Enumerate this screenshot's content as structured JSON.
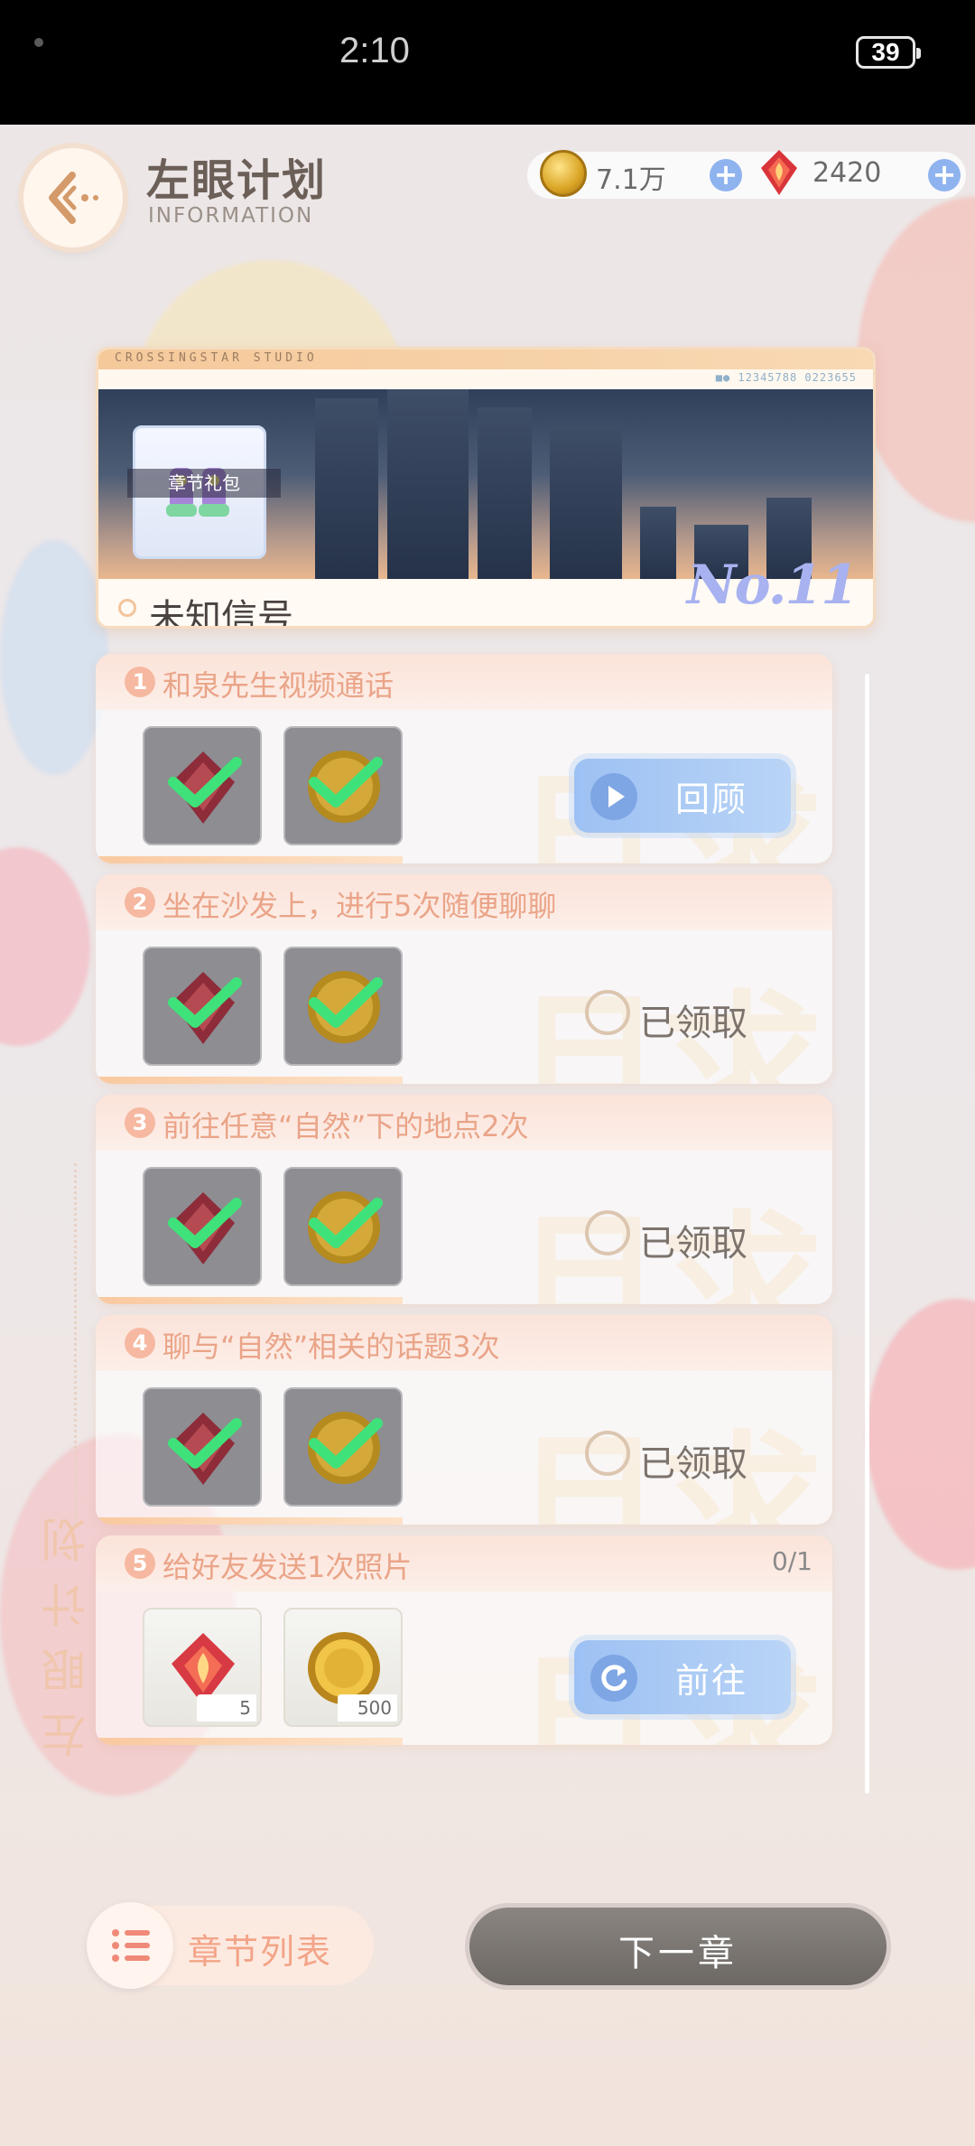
{
  "status_bar": {
    "time": "2:10",
    "battery": "39"
  },
  "header": {
    "title": "左眼计划",
    "subtitle": "INFORMATION",
    "coins": "7.1万",
    "gems": "2420"
  },
  "banner": {
    "studio": "CROSSINGSTAR STUDIO",
    "code": "■● 12345788 0223655",
    "gift_label": "章节礼包",
    "chapter_name": "未知信号",
    "chapter_no": "No.11"
  },
  "tasks": [
    {
      "num": "1",
      "title": "和泉先生视频通话",
      "status": "review",
      "button": "回顾"
    },
    {
      "num": "2",
      "title": "坐在沙发上，进行5次随便聊聊",
      "status": "claimed",
      "claimed_label": "已领取"
    },
    {
      "num": "3",
      "title": "前往任意“自然”下的地点2次",
      "status": "claimed",
      "claimed_label": "已领取"
    },
    {
      "num": "4",
      "title": "聊与“自然”相关的话题3次",
      "status": "claimed",
      "claimed_label": "已领取"
    },
    {
      "num": "5",
      "title": "给好友发送1次照片",
      "status": "go",
      "progress": "0/1",
      "button": "前往",
      "rewards": [
        {
          "icon": "gem-icon",
          "qty": "5"
        },
        {
          "icon": "coin-icon",
          "qty": "500"
        }
      ]
    }
  ],
  "side_label": "左眼计划",
  "bottom": {
    "chapter_list": "章节列表",
    "next_chapter": "下一章"
  },
  "colors": {
    "accent": "#eaa488",
    "button_blue": "#9dc1f3",
    "next_btn": "#7a7570"
  }
}
